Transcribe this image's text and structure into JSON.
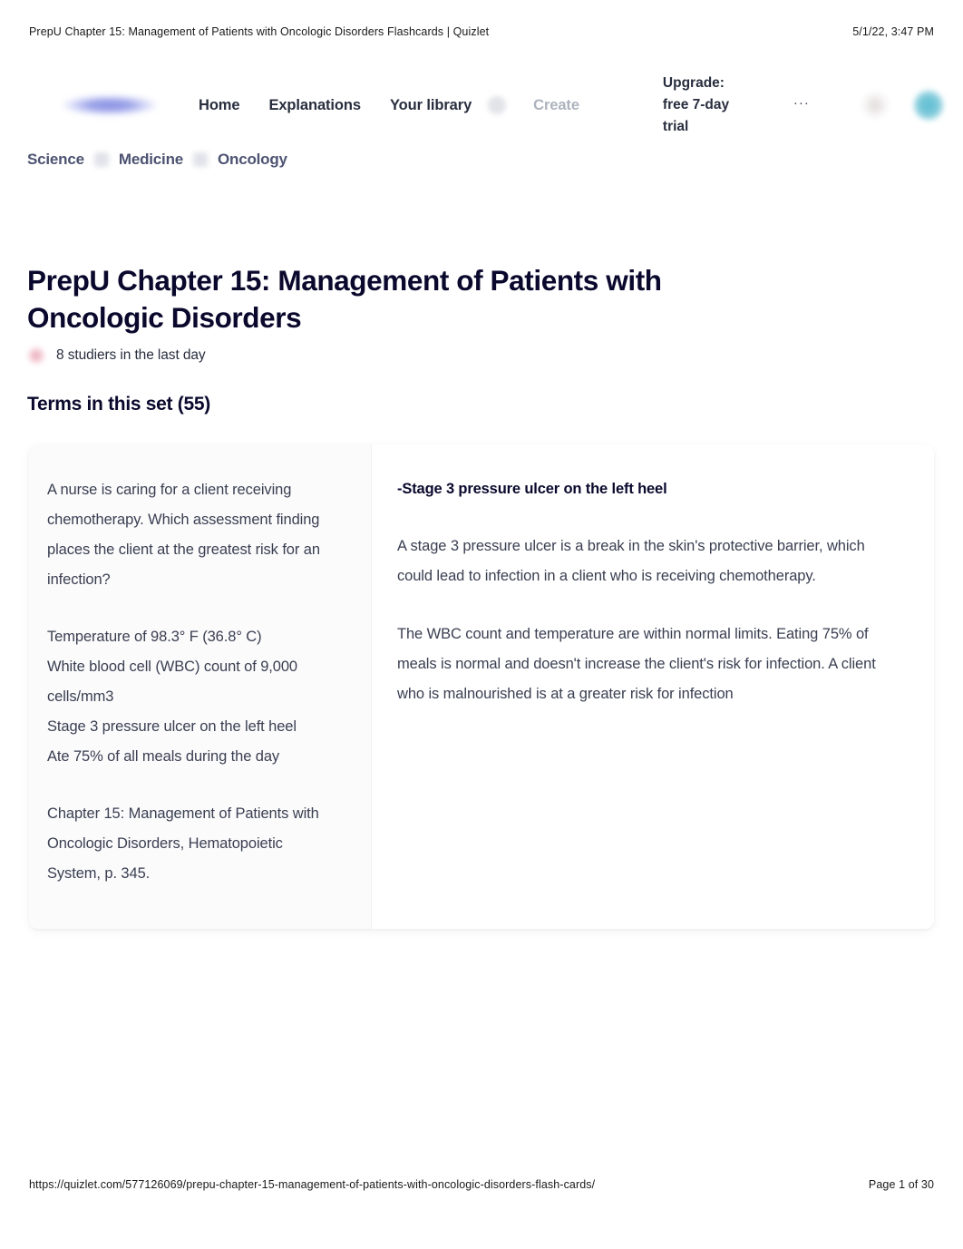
{
  "print_header": {
    "title": "PrepU Chapter 15: Management of Patients with Oncologic Disorders Flashcards | Quizlet",
    "timestamp": "5/1/22, 3:47 PM"
  },
  "nav": {
    "logo_alt": "Quizlet",
    "links": [
      {
        "label": "Home",
        "muted": false
      },
      {
        "label": "Explanations",
        "muted": false
      },
      {
        "label": "Your library",
        "muted": false
      },
      {
        "label": "Create",
        "muted": true
      }
    ],
    "upgrade_label": "Upgrade: free 7-day trial",
    "more_icon": "···"
  },
  "breadcrumb": {
    "items": [
      "Science",
      "Medicine",
      "Oncology"
    ]
  },
  "page": {
    "title": "PrepU Chapter 15: Management of Patients with Oncologic Disorders",
    "studiers": "8 studiers in the last day",
    "terms_heading": "Terms in this set (55)"
  },
  "card": {
    "term_paragraphs": [
      "A nurse is caring for a client receiving chemotherapy. Which assessment finding places the client at the greatest risk for an infection?",
      "Temperature of 98.3° F (36.8° C)\nWhite blood cell (WBC) count of 9,000 cells/mm3\nStage 3 pressure ulcer on the left heel\nAte 75% of all meals during the day",
      "Chapter 15: Management of Patients with Oncologic Disorders, Hematopoietic System, p. 345."
    ],
    "definition_title": "-Stage 3 pressure ulcer on the left heel",
    "definition_paragraphs": [
      "A stage 3 pressure ulcer is a break in the skin's protective barrier, which could lead to infection in a client who is receiving chemotherapy.",
      "The WBC count and temperature are within normal limits. Eating 75% of meals is normal and doesn't increase the client's risk for infection. A client who is malnourished is at a greater risk for infection"
    ]
  },
  "print_footer": {
    "url": "https://quizlet.com/577126069/prepu-chapter-15-management-of-patients-with-oncologic-disorders-flash-cards/",
    "page": "Page 1 of 30"
  },
  "colors": {
    "text_primary": "#0a092d",
    "text_body": "#3a3f51",
    "breadcrumb": "#4d5372",
    "muted": "#adb3bd",
    "brand_logo": "#8b92e3",
    "avatar": "#5fbed2",
    "studier_icon": "#e796a8"
  }
}
